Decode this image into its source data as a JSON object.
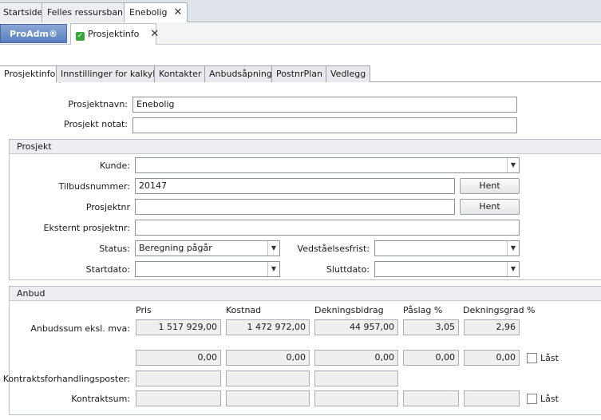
{
  "doc_tabs": [
    "Startside",
    "Felles ressursbank",
    "Enebolig"
  ],
  "app_button": "ProAdm®",
  "page_tab": "Prosjektinfo",
  "inner_tabs": [
    "Prosjektinfo",
    "Innstillinger for kalkyle",
    "Kontakter",
    "Anbudsåpning",
    "PostnrPlan",
    "Vedlegg"
  ],
  "top": {
    "prosjektnavn_label": "Prosjektnavn:",
    "prosjektnavn_value": "Enebolig",
    "notat_label": "Prosjekt notat:",
    "notat_value": ""
  },
  "prosjekt": {
    "title": "Prosjekt",
    "kunde_label": "Kunde:",
    "kunde_value": "",
    "tilbud_label": "Tilbudsnummer:",
    "tilbud_value": "20147",
    "prosjektnr_label": "Prosjektnr",
    "prosjektnr_value": "",
    "hent_label": "Hent",
    "ekstern_label": "Eksternt prosjektnr:",
    "ekstern_value": "",
    "status_label": "Status:",
    "status_value": "Beregning pågår",
    "vedstaelse_label": "Vedståelsesfrist:",
    "vedstaelse_value": "",
    "startdato_label": "Startdato:",
    "startdato_value": "",
    "sluttdato_label": "Sluttdato:",
    "sluttdato_value": ""
  },
  "anbud": {
    "title": "Anbud",
    "columns": [
      "Pris",
      "Kostnad",
      "Dekningsbidrag",
      "Påslag %",
      "Dekningsgrad %"
    ],
    "anbudssum_label": "Anbudssum eksl. mva:",
    "anbudssum": [
      "1 517 929,00",
      "1 472 972,00",
      "44 957,00",
      "3,05",
      "2,96"
    ],
    "row2": [
      "0,00",
      "0,00",
      "0,00",
      "0,00",
      "0,00"
    ],
    "kontraktsforh_label": "Kontraktsforhandlingsposter:",
    "kontraktsum_label": "Kontraktsum:",
    "laast_label": "Låst"
  }
}
